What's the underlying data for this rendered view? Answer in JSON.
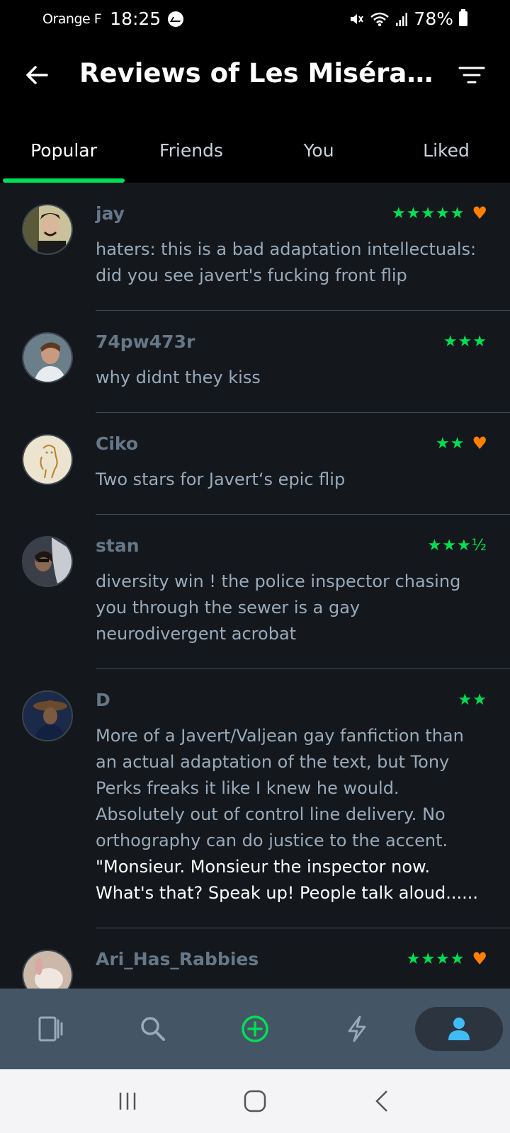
{
  "status": {
    "carrier": "Orange F",
    "time": "18:25",
    "battery": "78%"
  },
  "header": {
    "title": "Reviews of Les Misérab..."
  },
  "tabs": [
    {
      "label": "Popular",
      "active": true
    },
    {
      "label": "Friends",
      "active": false
    },
    {
      "label": "You",
      "active": false
    },
    {
      "label": "Liked",
      "active": false
    }
  ],
  "reviews": [
    {
      "username": "jay",
      "stars": "★★★★★",
      "rating": 5,
      "liked": true,
      "text": "haters: this is a bad adaptation intellectuals: did you see javert's fucking front flip"
    },
    {
      "username": "74pw473r",
      "stars": "★★★",
      "rating": 3,
      "liked": false,
      "text": "why didnt they kiss"
    },
    {
      "username": "Ciko",
      "stars": "★★",
      "rating": 2,
      "liked": true,
      "text": "Two stars for Javert‘s epic flip"
    },
    {
      "username": "stan",
      "stars": "★★★½",
      "rating": 3.5,
      "liked": false,
      "text": "diversity win ! the police inspector chasing you through the sewer is a gay neurodivergent acrobat"
    },
    {
      "username": "D",
      "stars": "★★",
      "rating": 2,
      "liked": false,
      "text": "More of a Javert/Valjean gay fanfiction than an actual adaptation of the text, but Tony Perks freaks it like I knew he would. Absolutely out of control line delivery. No orthography can do justice to the accent.",
      "highlight": "\"Monsieur. Monsieur the inspector now. What's that? Speak up! People talk aloud......"
    },
    {
      "username": "Ari_Has_Rabbies",
      "stars": "★★★★",
      "rating": 4,
      "liked": true,
      "text": ""
    }
  ],
  "bottom_nav": [
    {
      "icon": "films-icon",
      "active": false
    },
    {
      "icon": "search-icon",
      "active": false
    },
    {
      "icon": "add-icon",
      "active": false
    },
    {
      "icon": "activity-icon",
      "active": false
    },
    {
      "icon": "profile-icon",
      "active": true
    }
  ],
  "colors": {
    "accent_green": "#00e054",
    "heart_orange": "#ff8000",
    "background": "#14181c",
    "nav_bg": "#445566"
  }
}
